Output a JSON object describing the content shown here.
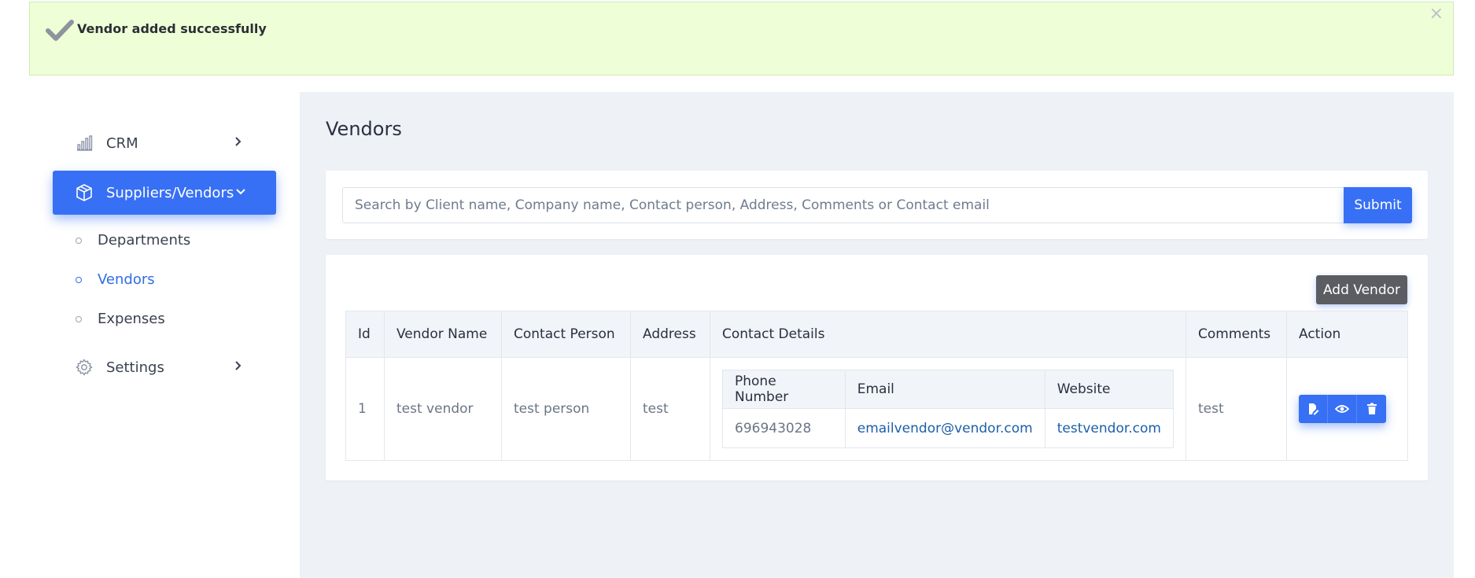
{
  "alert": {
    "message": "Vendor added successfully",
    "close": "×"
  },
  "sidebar": {
    "crm": "CRM",
    "suppliers": "Suppliers/Vendors",
    "sub": [
      "Departments",
      "Vendors",
      "Expenses"
    ],
    "settings": "Settings"
  },
  "page": {
    "title": "Vendors"
  },
  "search": {
    "placeholder": "Search by Client name, Company name, Contact person, Address, Comments or Contact email",
    "submit_label": "Submit"
  },
  "table": {
    "add_label": "Add Vendor",
    "headers": [
      "Id",
      "Vendor Name",
      "Contact Person",
      "Address",
      "Contact Details",
      "Comments",
      "Action"
    ],
    "inner_headers": [
      "Phone Number",
      "Email",
      "Website"
    ],
    "row": {
      "id": "1",
      "vendor_name": "test vendor",
      "contact_person": "test person",
      "address": "test",
      "phone": "696943028",
      "email": "emailvendor@vendor.com",
      "website": "testvendor.com",
      "comments": "test"
    }
  },
  "colors": {
    "accent": "#3770f4",
    "alert_bg": "#eeffd8",
    "main_bg": "#eef1f5"
  }
}
